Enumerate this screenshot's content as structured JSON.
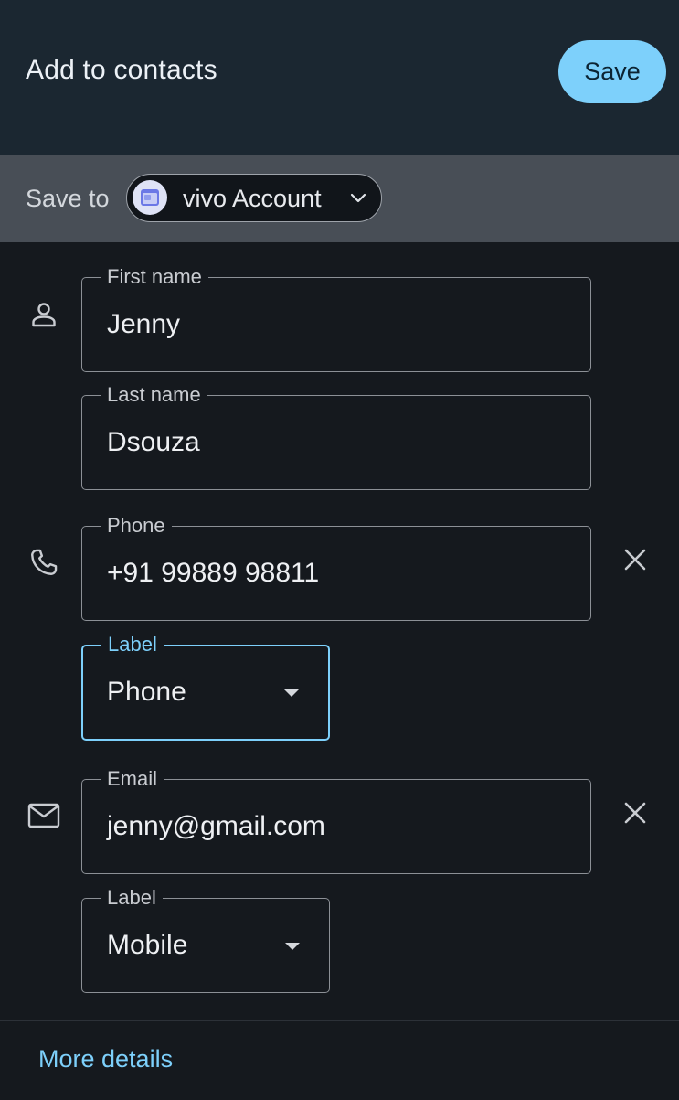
{
  "header": {
    "title": "Add to contacts",
    "save_label": "Save"
  },
  "save_to": {
    "label": "Save to",
    "account": "vivo Account"
  },
  "fields": {
    "first_name": {
      "label": "First name",
      "value": "Jenny"
    },
    "last_name": {
      "label": "Last name",
      "value": "Dsouza"
    },
    "phone": {
      "label": "Phone",
      "value": "+91 99889 98811"
    },
    "phone_label": {
      "label": "Label",
      "value": "Phone"
    },
    "email": {
      "label": "Email",
      "value": "jenny@gmail.com"
    },
    "email_label": {
      "label": "Label",
      "value": "Mobile"
    }
  },
  "footer": {
    "more_details": "More details"
  },
  "icons": {
    "person": "person-icon",
    "phone": "phone-icon",
    "email": "mail-icon",
    "clear": "close-icon",
    "dropdown": "caret-down-icon",
    "chevron": "chevron-down-icon",
    "account": "account-icon"
  },
  "colors": {
    "accent": "#7dd0fb",
    "header_bg": "#1b2731",
    "saveto_bg": "#484e56",
    "page_bg": "#15191e"
  }
}
